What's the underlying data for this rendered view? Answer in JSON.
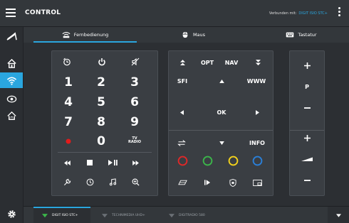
{
  "app": {
    "title": "CONTROL",
    "connected_label": "Verbunden mit:",
    "connected_device": "DIGIT ISIO STC+"
  },
  "tabs": [
    {
      "label": "Fernbedienung",
      "icon": "remote-icon",
      "active": true
    },
    {
      "label": "Maus",
      "icon": "mouse-icon",
      "active": false
    },
    {
      "label": "Tastatur",
      "icon": "keyboard-icon",
      "active": false
    }
  ],
  "sidebar": [
    {
      "icon": "pointer-icon"
    },
    {
      "icon": "home-icon"
    },
    {
      "icon": "wifi-icon",
      "active": true
    },
    {
      "icon": "eye-icon"
    },
    {
      "icon": "home-wifi-icon"
    },
    {
      "icon": "gear-icon"
    }
  ],
  "numpad": {
    "digits": [
      "1",
      "2",
      "3",
      "4",
      "5",
      "6",
      "7",
      "8",
      "9",
      "0"
    ],
    "tv_radio": "TV\nRADIO"
  },
  "nav": {
    "opt": "OPT",
    "nav": "NAV",
    "sfi": "SFI",
    "www": "WWW",
    "ok": "OK",
    "info": "INFO"
  },
  "volume": {
    "p": "P"
  },
  "colors": {
    "accent": "#2aa6df",
    "red": "#e02828",
    "green": "#3bb54a",
    "yellow": "#f3d21c",
    "blue": "#2a7fd8",
    "record": "#e31b1b"
  },
  "devices": [
    {
      "label": "DIGIT ISIO STC+",
      "active": true
    },
    {
      "label": "TECHNIMEDIA UHD+",
      "active": false
    },
    {
      "label": "DIGITRADIO 580",
      "active": false
    }
  ]
}
